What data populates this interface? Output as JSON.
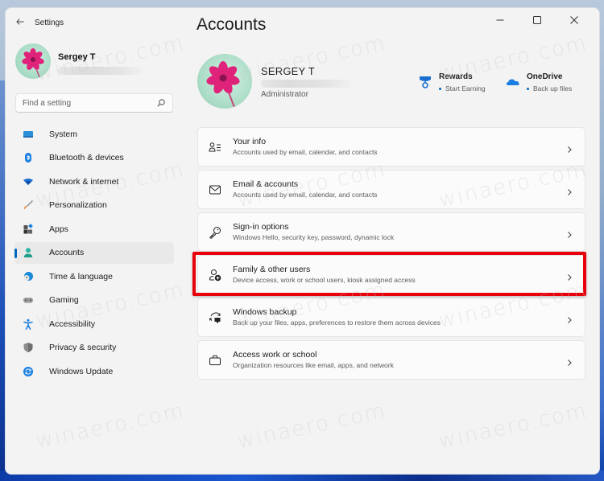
{
  "window": {
    "app_title": "Settings",
    "controls": {
      "minimize": "minimize",
      "maximize": "maximize",
      "close": "close"
    }
  },
  "sidebar": {
    "profile": {
      "name": "Sergey T"
    },
    "search": {
      "placeholder": "Find a setting",
      "value": ""
    },
    "items": [
      {
        "label": "System",
        "icon": "system-icon",
        "selected": false
      },
      {
        "label": "Bluetooth & devices",
        "icon": "bluetooth-icon",
        "selected": false
      },
      {
        "label": "Network & internet",
        "icon": "wifi-icon",
        "selected": false
      },
      {
        "label": "Personalization",
        "icon": "brush-icon",
        "selected": false
      },
      {
        "label": "Apps",
        "icon": "apps-icon",
        "selected": false
      },
      {
        "label": "Accounts",
        "icon": "person-icon",
        "selected": true
      },
      {
        "label": "Time & language",
        "icon": "globe-clock-icon",
        "selected": false
      },
      {
        "label": "Gaming",
        "icon": "gamepad-icon",
        "selected": false
      },
      {
        "label": "Accessibility",
        "icon": "accessibility-icon",
        "selected": false
      },
      {
        "label": "Privacy & security",
        "icon": "shield-icon",
        "selected": false
      },
      {
        "label": "Windows Update",
        "icon": "update-icon",
        "selected": false
      }
    ]
  },
  "main": {
    "title": "Accounts",
    "user": {
      "name": "SERGEY T",
      "role": "Administrator"
    },
    "quick_links": [
      {
        "title": "Rewards",
        "subtitle": "Start Earning",
        "icon": "rewards-medal-icon"
      },
      {
        "title": "OneDrive",
        "subtitle": "Back up files",
        "icon": "onedrive-cloud-icon"
      }
    ],
    "cards": [
      {
        "title": "Your info",
        "subtitle": "Accounts used by email, calendar, and contacts",
        "icon": "person-list-icon"
      },
      {
        "title": "Email & accounts",
        "subtitle": "Accounts used by email, calendar, and contacts",
        "icon": "mail-icon"
      },
      {
        "title": "Sign-in options",
        "subtitle": "Windows Hello, security key, password, dynamic lock",
        "icon": "key-icon"
      },
      {
        "title": "Family & other users",
        "subtitle": "Device access, work or school users, kiosk assigned access",
        "icon": "person-add-icon",
        "highlighted": true
      },
      {
        "title": "Windows backup",
        "subtitle": "Back up your files, apps, preferences to restore them across devices",
        "icon": "backup-icon"
      },
      {
        "title": "Access work or school",
        "subtitle": "Organization resources like email, apps, and network",
        "icon": "briefcase-icon"
      }
    ],
    "highlight_color": "#e8000b"
  },
  "colors": {
    "accent": "#0067c0",
    "window_bg": "#f3f3f3",
    "card_bg": "#fbfbfb"
  },
  "watermark": "winaero.com"
}
